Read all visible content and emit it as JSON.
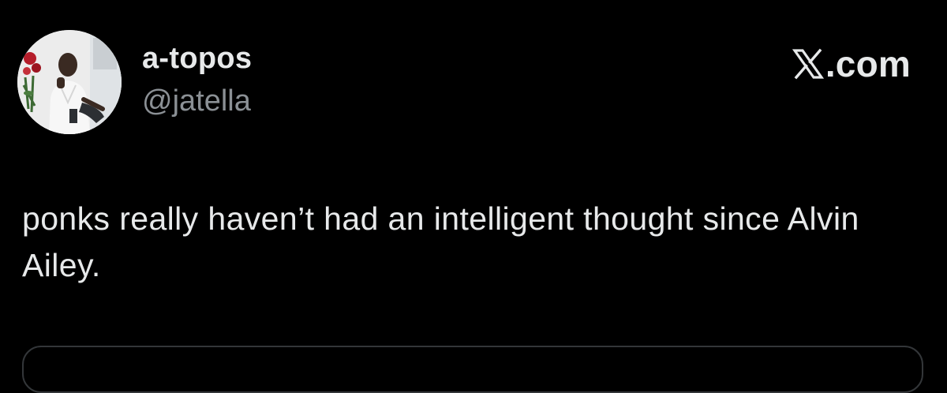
{
  "author": {
    "display_name": "a-topos",
    "handle": "@jatella",
    "avatar_icon": "profile-photo"
  },
  "brand": {
    "label": ".com",
    "icon": "x-logo-icon"
  },
  "tweet": {
    "text": "ponks really haven’t had an intelligent thought since Alvin Ailey."
  },
  "colors": {
    "background": "#000000",
    "primary_text": "#e7e9ea",
    "secondary_text": "#8b9095",
    "border": "#333639"
  }
}
